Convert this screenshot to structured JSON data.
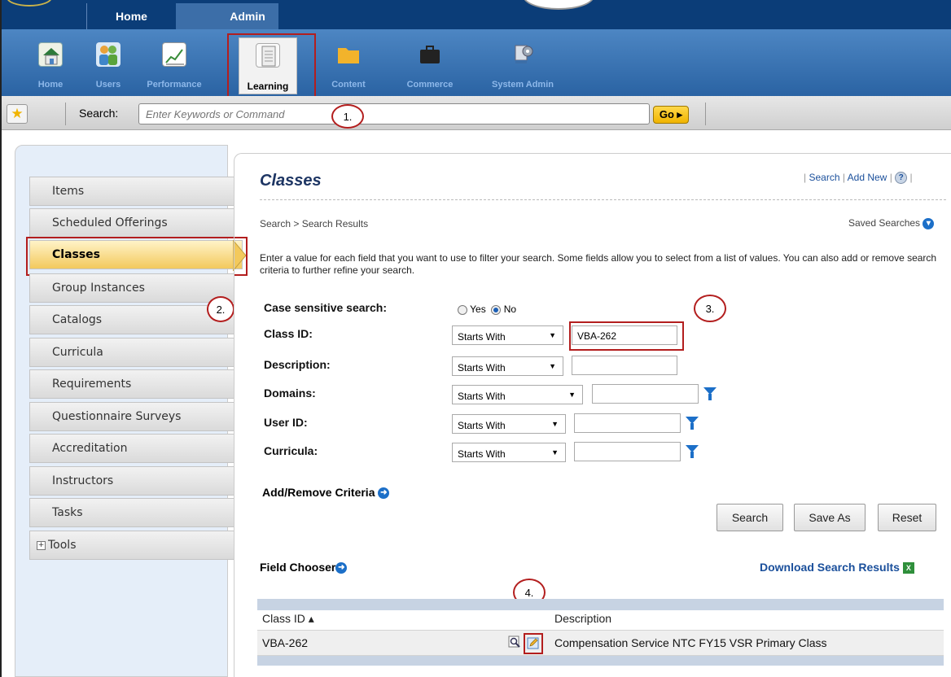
{
  "top_nav": {
    "home_label": "Home",
    "admin_label": "Admin"
  },
  "icon_bar": [
    {
      "label": "Home",
      "icon": "home-icon"
    },
    {
      "label": "Users",
      "icon": "users-icon"
    },
    {
      "label": "Performance",
      "icon": "performance-icon"
    },
    {
      "label": "Learning",
      "icon": "learning-icon"
    },
    {
      "label": "Content",
      "icon": "folder-icon"
    },
    {
      "label": "Commerce",
      "icon": "briefcase-icon"
    },
    {
      "label": "System Admin",
      "icon": "system-admin-icon"
    }
  ],
  "search_bar": {
    "label": "Search:",
    "placeholder": "Enter Keywords or Command",
    "go_label": "Go ▸"
  },
  "annotations": {
    "a1": "1.",
    "a2": "2.",
    "a3": "3.",
    "a4": "4."
  },
  "sidebar": {
    "items": [
      "Items",
      "Scheduled Offerings",
      "Classes",
      "Group Instances",
      "Catalogs",
      "Curricula",
      "Requirements",
      "Questionnaire Surveys",
      "Accreditation",
      "Instructors",
      "Tasks",
      "Tools"
    ],
    "active": "Classes"
  },
  "main": {
    "title": "Classes",
    "links": {
      "search": "Search",
      "add_new": "Add New"
    },
    "breadcrumb": "Search > Search Results",
    "saved_searches": "Saved Searches",
    "instructions": "Enter a value for each field that you want to use to filter your search. Some fields allow you to select from a list of values. You can also add or remove search criteria to further refine your search.",
    "case_sensitive": {
      "label": "Case sensitive search:",
      "yes": "Yes",
      "no": "No",
      "selected": "No"
    },
    "fields": [
      {
        "label": "Class ID:",
        "operator": "Starts With",
        "value": "VBA-262"
      },
      {
        "label": "Description:",
        "operator": "Starts With",
        "value": ""
      },
      {
        "label": "Domains:",
        "operator": "Starts With",
        "value": ""
      },
      {
        "label": "User ID:",
        "operator": "Starts With",
        "value": ""
      },
      {
        "label": "Curricula:",
        "operator": "Starts With",
        "value": ""
      }
    ],
    "add_remove": "Add/Remove Criteria",
    "buttons": {
      "search": "Search",
      "save_as": "Save As",
      "reset": "Reset"
    },
    "field_chooser": "Field Chooser",
    "download": "Download Search Results"
  },
  "results": {
    "columns": [
      "Class ID ▴",
      "Description"
    ],
    "rows": [
      {
        "class_id": "VBA-262",
        "description": "Compensation Service NTC FY15 VSR Primary Class"
      }
    ]
  },
  "colors": {
    "nav_dark": "#0b3d78",
    "accent_blue": "#1c6fc8",
    "highlight_red": "#b31e1e",
    "active_tab": "#f3c95c"
  }
}
